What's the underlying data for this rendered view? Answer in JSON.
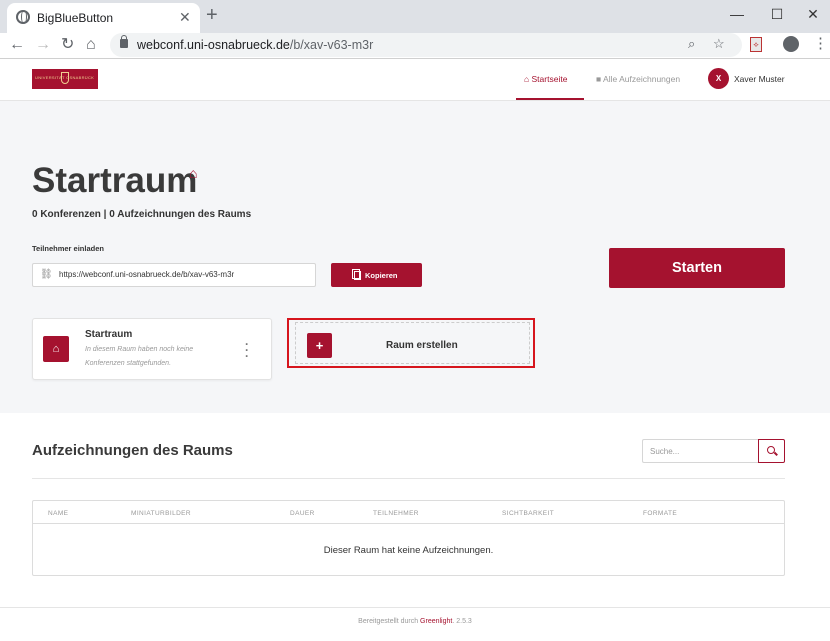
{
  "browser": {
    "tab_title": "BigBlueButton",
    "tab_close": "✕",
    "new_tab": "+",
    "url_host": "webconf.uni-osnabrueck.de",
    "url_path": "/b/xav-v63-m3r",
    "window_controls": [
      "—",
      "☐",
      "✕"
    ]
  },
  "header": {
    "logo_text": "UNIVERSITÄT OSNABRÜCK",
    "nav": [
      {
        "icon": "home-icon",
        "label": "Startseite",
        "active": true
      },
      {
        "icon": "video-icon",
        "label": "Alle Aufzeichnungen",
        "active": false
      }
    ],
    "user_initial": "X",
    "user_name": "Xaver Muster"
  },
  "room": {
    "title": "Startraum",
    "stats": "0 Konferenzen | 0 Aufzeichnungen des Raums",
    "invite_label": "Teilnehmer einladen",
    "invite_url": "https://webconf.uni-osnabrueck.de/b/xav-v63-m3r",
    "copy_label": "Kopieren",
    "start_label": "Starten"
  },
  "room_card": {
    "title": "Startraum",
    "description": "In diesem Raum haben noch keine Konferenzen stattgefunden."
  },
  "create_room": {
    "label": "Raum erstellen"
  },
  "recordings": {
    "title": "Aufzeichnungen des Raums",
    "search_placeholder": "Suche...",
    "columns": [
      "NAME",
      "MINIATURBILDER",
      "DAUER",
      "TEILNEHMER",
      "SICHTBARKEIT",
      "FORMATE"
    ],
    "empty_message": "Dieser Raum hat keine Aufzeichnungen."
  },
  "footer": {
    "prefix": "Bereitgestellt durch",
    "link": "Greenlight",
    "version": ". 2.5.3"
  },
  "colors": {
    "brand": "#a5122f",
    "highlight_border": "#d6151d"
  }
}
